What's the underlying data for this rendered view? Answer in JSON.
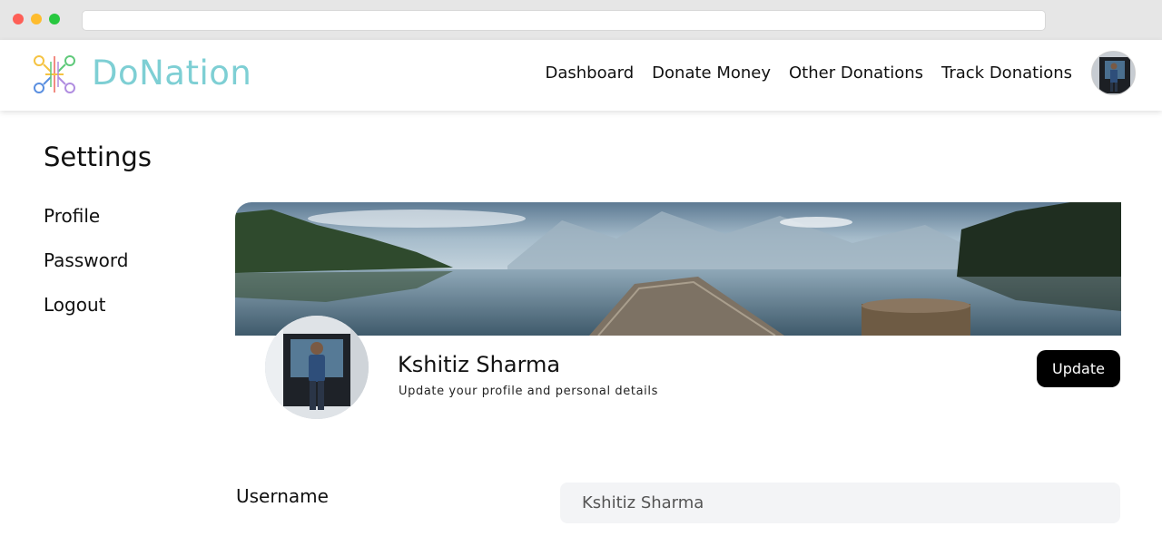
{
  "app": {
    "brand": "DoNation",
    "brand_color": "#7ecfd4"
  },
  "nav": {
    "links": [
      "Dashboard",
      "Donate Money",
      "Other Donations",
      "Track Donations"
    ]
  },
  "sidebar": {
    "title": "Settings",
    "items": [
      {
        "label": "Profile",
        "active": true
      },
      {
        "label": "Password",
        "active": false
      },
      {
        "label": "Logout",
        "active": false
      }
    ]
  },
  "profile": {
    "name": "Kshitiz Sharma",
    "subtitle": "Update your profile and personal details",
    "update_label": "Update"
  },
  "form": {
    "username_label": "Username",
    "username_value": "Kshitiz Sharma"
  },
  "icons": {
    "logo": "donation-logo-icon",
    "avatar": "user-avatar"
  }
}
